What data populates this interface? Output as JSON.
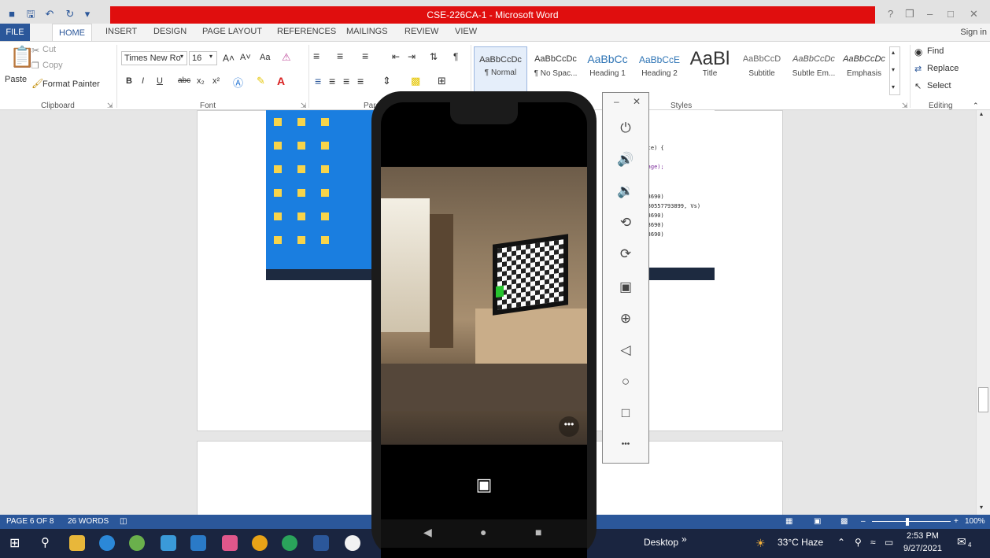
{
  "window": {
    "title": "CSE-226CA-1 - Microsoft Word",
    "help": "?",
    "restore": "❒",
    "minimize": "–",
    "maximize": "□",
    "close": "✕"
  },
  "tabs": [
    "FILE",
    "HOME",
    "INSERT",
    "DESIGN",
    "PAGE LAYOUT",
    "REFERENCES",
    "MAILINGS",
    "REVIEW",
    "VIEW"
  ],
  "sign_in": "Sign in",
  "clipboard": {
    "paste": "Paste",
    "cut": "Cut",
    "copy": "Copy",
    "format_painter": "Format Painter",
    "label": "Clipboard"
  },
  "font": {
    "family": "Times New Ro",
    "size": "16",
    "label": "Font",
    "bold": "B",
    "italic": "I",
    "underline": "U",
    "strike": "abc",
    "subscript": "x₂",
    "superscript": "x²",
    "grow": "A˄",
    "shrink": "A˅",
    "case": "Aa"
  },
  "paragraph": {
    "label": "Paragraph",
    "pilcrow": "¶"
  },
  "styles": {
    "label": "Styles",
    "items": [
      {
        "sample": "AaBbCcDc",
        "name": "¶ Normal"
      },
      {
        "sample": "AaBbCcDc",
        "name": "¶ No Spac..."
      },
      {
        "sample": "AaBbCc",
        "name": "Heading 1"
      },
      {
        "sample": "AaBbCcE",
        "name": "Heading 2"
      },
      {
        "sample": "AaBl",
        "name": "Title"
      },
      {
        "sample": "AaBbCcD",
        "name": "Subtitle"
      },
      {
        "sample": "AaBbCcDc",
        "name": "Subtle Em..."
      },
      {
        "sample": "AaBbCcDc",
        "name": "Emphasis"
      }
    ]
  },
  "editing": {
    "find": "Find",
    "replace": "Replace",
    "select": "Select",
    "label": "Editing"
  },
  "code_lines": [
    "State) {",
    "t_page);",
    "fd03690)",
    ":=180557793899, Vs)",
    "fd03690)",
    "fd03690)",
    "fd03690)"
  ],
  "status": {
    "page": "PAGE 6 OF 8",
    "words": "26 WORDS",
    "zoom": "100%"
  },
  "taskbar": {
    "desktop": "Desktop",
    "chevron": "»",
    "weather": "33°C  Haze",
    "time": "2:53 PM",
    "date": "9/27/2021",
    "notifications": "4"
  },
  "emulator": {
    "minimize": "–",
    "close": "✕",
    "more": "•••",
    "scene_more": "•••"
  }
}
